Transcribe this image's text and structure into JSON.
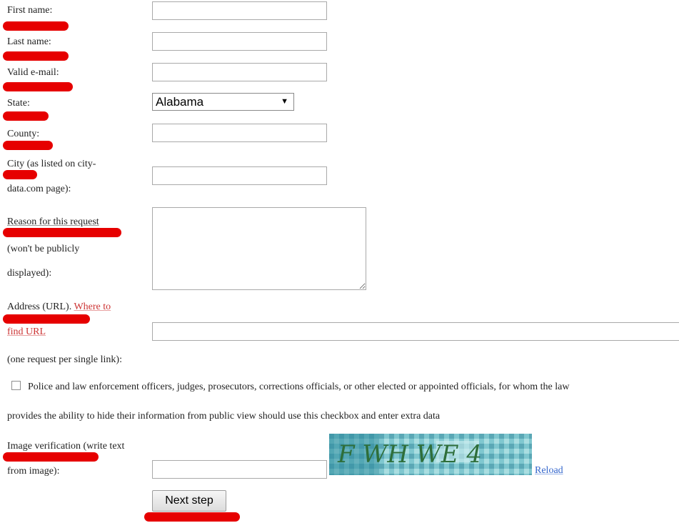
{
  "form": {
    "first_name_label": "First name:",
    "last_name_label": "Last name:",
    "email_label": "Valid e-mail:",
    "state_label": "State:",
    "state_value": "Alabama",
    "county_label": "County:",
    "city_label_line1": "City (as listed on city-",
    "city_label_line2": "data.com page):",
    "reason_label_line1": "Reason for this request",
    "reason_label_line2": "(won't be publicly",
    "reason_label_line3": "displayed):",
    "address_label": "Address (URL).",
    "where_to_link_part1": "Where to",
    "where_to_link_part2": "find URL",
    "address_note": "(one request per single link):",
    "police_checkbox_text_line1": "Police and law enforcement officers, judges, prosecutors, corrections officials, or other elected or appointed officials, for whom the law",
    "police_checkbox_text_line2": "provides the ability to hide their information from public view should use this checkbox and enter extra data",
    "image_verification_line1": "Image verification (write text",
    "image_verification_line2": "from image):",
    "captcha_text": "F WH WE 4",
    "reload_link": "Reload",
    "next_step_button": "Next step"
  },
  "colors": {
    "redaction": "#e60000",
    "link": "#cc3333"
  }
}
